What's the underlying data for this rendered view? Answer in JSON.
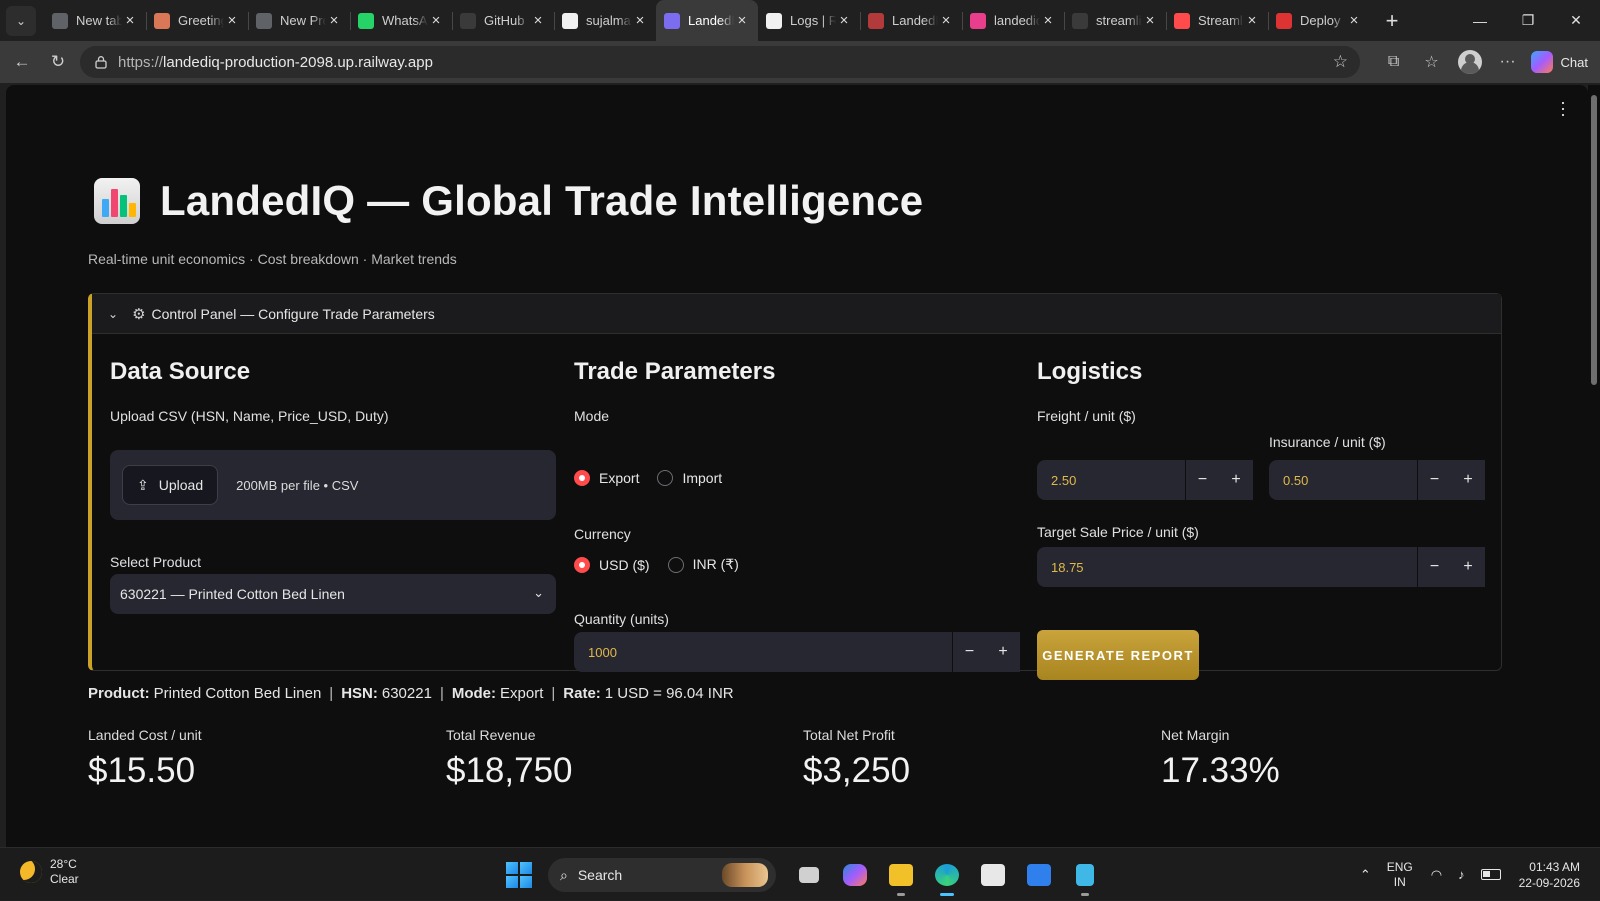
{
  "browser": {
    "tabs": [
      {
        "title": "New tab",
        "icon": "newtab-icon",
        "color": "#5f6368"
      },
      {
        "title": "Greeting",
        "icon": "claude-icon",
        "color": "#d97757"
      },
      {
        "title": "New Project",
        "icon": "page-icon",
        "color": "#5f6368"
      },
      {
        "title": "WhatsApp",
        "icon": "whatsapp-icon",
        "color": "#25d366"
      },
      {
        "title": "GitHub",
        "icon": "search-icon",
        "color": "#3a3a3a"
      },
      {
        "title": "sujalmane",
        "icon": "github-icon",
        "color": "#f0f0f0"
      },
      {
        "title": "LandedIQ",
        "icon": "chart-icon",
        "color": "#7c6cf0",
        "active": true
      },
      {
        "title": "Logs | Railway",
        "icon": "railway-icon",
        "color": "#f0f0f0"
      },
      {
        "title": "LandedIQ",
        "icon": "landed-icon",
        "color": "#b33a3a"
      },
      {
        "title": "landediq",
        "icon": "g-icon",
        "color": "#e83e8c"
      },
      {
        "title": "streamlit",
        "icon": "search-icon",
        "color": "#3a3a3a"
      },
      {
        "title": "Streamlit",
        "icon": "streamlit-icon",
        "color": "#ff4b4b"
      },
      {
        "title": "Deploy",
        "icon": "deploy-icon",
        "color": "#d33"
      }
    ],
    "url_prefix": "https://",
    "url_host": "landediq-production-2098.up.railway.app",
    "chat_label": "Chat"
  },
  "app": {
    "title": "LandedIQ — Global Trade Intelligence",
    "subtitle": "Real-time unit economics · Cost breakdown · Market trends",
    "panel_title": "Control Panel — Configure Trade Parameters",
    "data_source": {
      "heading": "Data Source",
      "upload_label": "Upload CSV (HSN, Name, Price_USD, Duty)",
      "upload_button": "Upload",
      "upload_hint": "200MB per file • CSV",
      "select_label": "Select Product",
      "selected_product": "630221 — Printed Cotton Bed Linen"
    },
    "trade": {
      "heading": "Trade Parameters",
      "mode_label": "Mode",
      "mode_options": [
        "Export",
        "Import"
      ],
      "mode_selected": "Export",
      "currency_label": "Currency",
      "currency_options": [
        "USD ($)",
        "INR (₹)"
      ],
      "currency_selected": "USD ($)",
      "quantity_label": "Quantity (units)",
      "quantity": "1000"
    },
    "logistics": {
      "heading": "Logistics",
      "freight_label": "Freight / unit ($)",
      "freight": "2.50",
      "insurance_label": "Insurance / unit ($)",
      "insurance": "0.50",
      "target_label": "Target Sale Price / unit ($)",
      "target": "18.75",
      "generate_button": "GENERATE REPORT"
    },
    "summary": {
      "product_key": "Product:",
      "product_val": "Printed Cotton Bed Linen",
      "hsn_key": "HSN:",
      "hsn_val": "630221",
      "mode_key": "Mode:",
      "mode_val": "Export",
      "rate_key": "Rate:",
      "rate_val": "1 USD = 96.04 INR",
      "separator": "|"
    },
    "metrics": [
      {
        "label": "Landed Cost / unit",
        "value": "$15.50"
      },
      {
        "label": "Total Revenue",
        "value": "$18,750"
      },
      {
        "label": "Total Net Profit",
        "value": "$3,250"
      },
      {
        "label": "Net Margin",
        "value": "17.33%"
      }
    ],
    "accent_color": "#c9a227",
    "radio_color": "#ff4b4b"
  },
  "taskbar": {
    "temp": "28°C",
    "condition": "Clear",
    "search_label": "Search",
    "lang_1": "ENG",
    "lang_2": "IN",
    "time": "01:43 AM",
    "date": "22-09-2026"
  }
}
